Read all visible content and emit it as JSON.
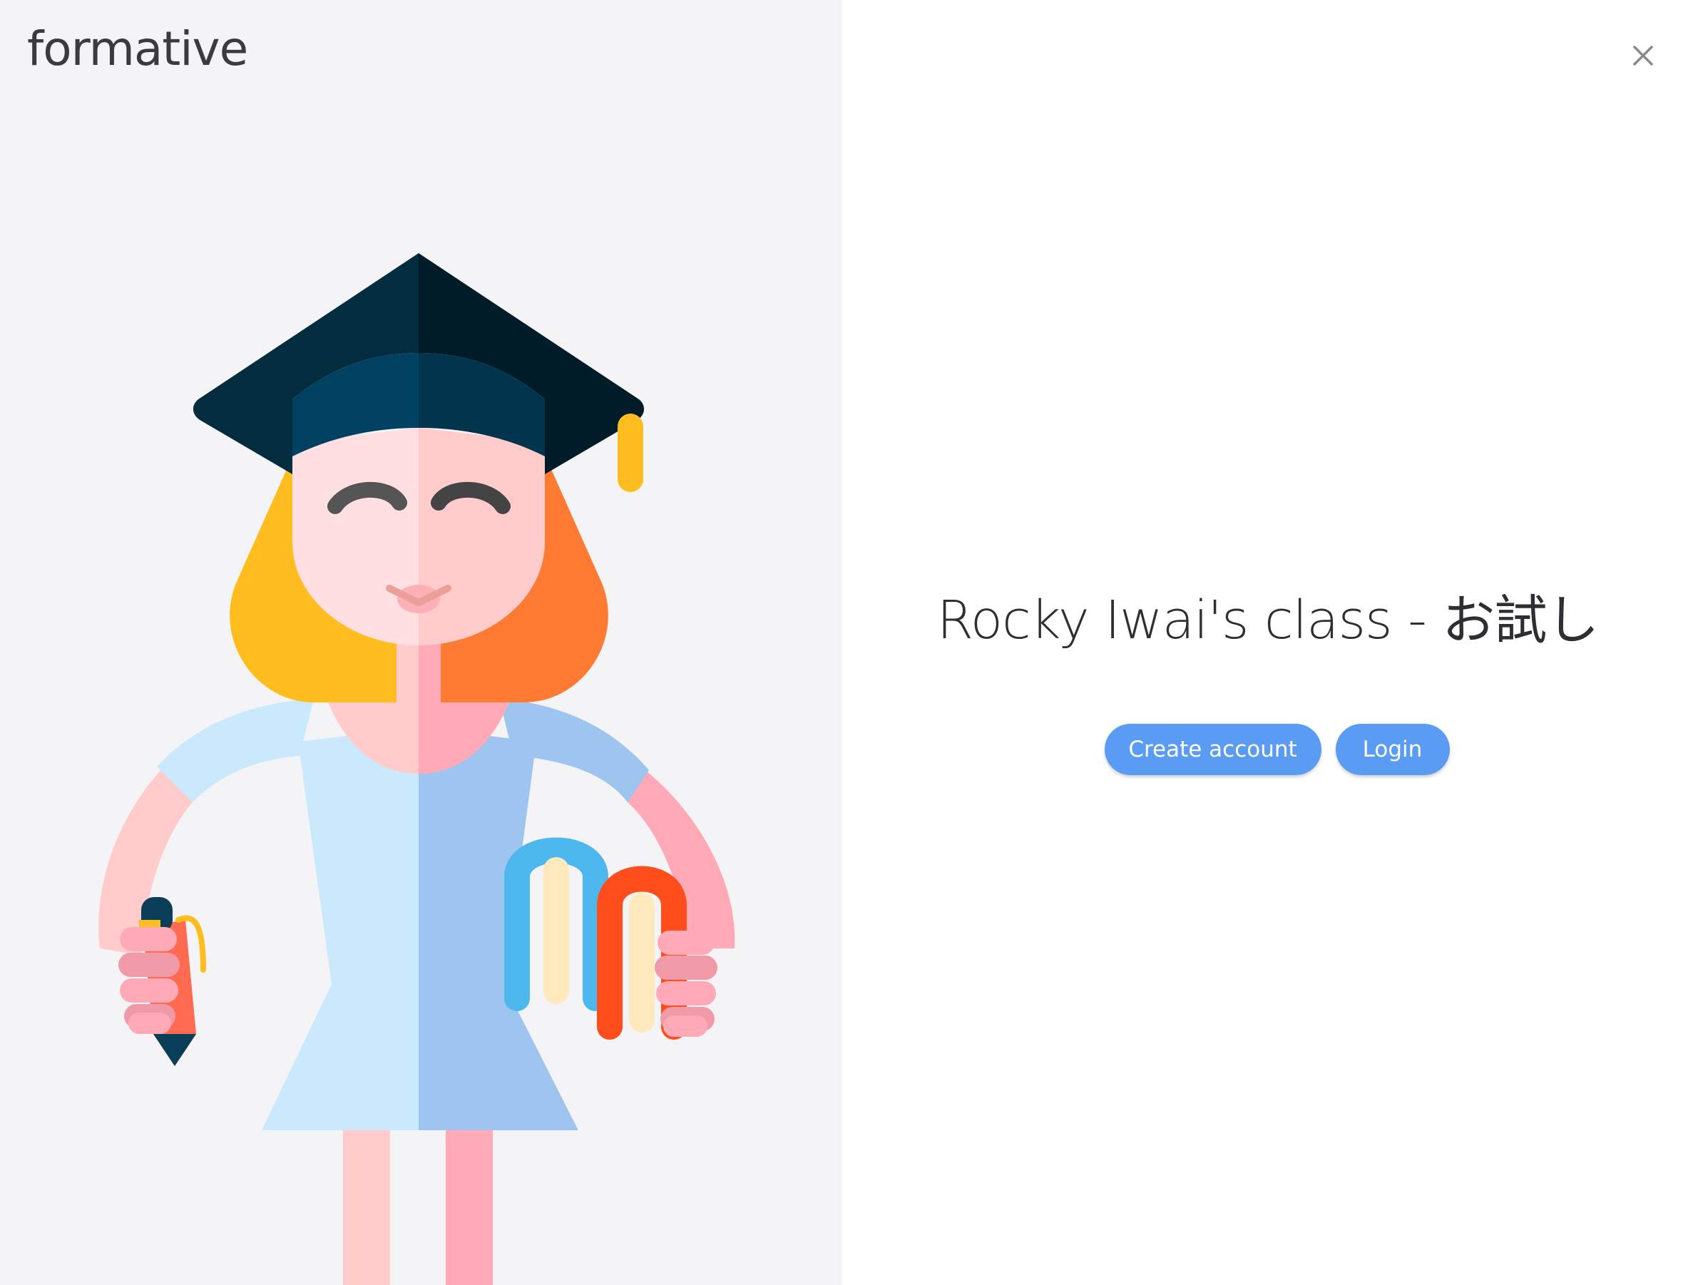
{
  "brand": {
    "logo_text": "formative"
  },
  "header": {
    "close_icon": "close-icon"
  },
  "main": {
    "class_title": "Rocky Iwai's class - お試し",
    "buttons": {
      "create_account_label": "Create account",
      "login_label": "Login"
    }
  },
  "colors": {
    "left_panel_bg": "#f4f4f6",
    "button_bg": "#5a9cf4",
    "button_text": "#ffffff",
    "title_text": "#2f2f33"
  },
  "illustration": {
    "subject": "graduate-student-illustration"
  }
}
